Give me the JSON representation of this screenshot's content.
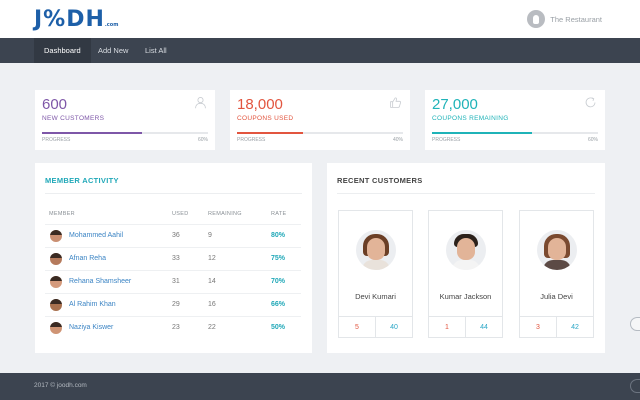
{
  "header": {
    "logo_text": "J%DH",
    "logo_sub": ".com",
    "user_name": "The Restaurant",
    "user_icon": "lightbulb-avatar"
  },
  "nav": {
    "items": [
      {
        "label": "Dashboard",
        "active": true
      },
      {
        "label": "Add New",
        "active": false
      },
      {
        "label": "List All",
        "active": false
      }
    ]
  },
  "stats": [
    {
      "value": "600",
      "label": "NEW CUSTOMERS",
      "progress_label": "PROGRESS",
      "progress_text": "60%",
      "progress": 0.6,
      "color": "#7e57a8",
      "icon": "user-icon"
    },
    {
      "value": "18,000",
      "label": "COUPONS USED",
      "progress_label": "PROGRESS",
      "progress_text": "40%",
      "progress": 0.4,
      "color": "#e2553f",
      "icon": "thumbs-up-icon"
    },
    {
      "value": "27,000",
      "label": "COUPONS REMAINING",
      "progress_label": "PROGRESS",
      "progress_text": "60%",
      "progress": 0.6,
      "color": "#1fb3b8",
      "icon": "refresh-icon"
    }
  ],
  "member_activity": {
    "title": "MEMBER ACTIVITY",
    "columns": [
      "MEMBER",
      "USED",
      "REMAINING",
      "RATE"
    ],
    "rows": [
      {
        "name": "Mohammed Aahil",
        "used": "36",
        "remaining": "9",
        "rate": "80%"
      },
      {
        "name": "Afnan Reha",
        "used": "33",
        "remaining": "12",
        "rate": "75%"
      },
      {
        "name": "Rehana Shamsheer",
        "used": "31",
        "remaining": "14",
        "rate": "70%"
      },
      {
        "name": "Al Rahim Khan",
        "used": "29",
        "remaining": "16",
        "rate": "66%"
      },
      {
        "name": "Naziya Kiswer",
        "used": "23",
        "remaining": "22",
        "rate": "50%"
      }
    ]
  },
  "recent_customers": {
    "title": "RECENT CUSTOMERS",
    "customers": [
      {
        "name": "Devi Kumari",
        "left": "5",
        "right": "40"
      },
      {
        "name": "Kumar Jackson",
        "left": "1",
        "right": "44"
      },
      {
        "name": "Julia Devi",
        "left": "3",
        "right": "42"
      }
    ]
  },
  "footer": {
    "text": "2017 © joodh.com"
  },
  "colors": {
    "brand": "#1d5fa8",
    "nav_bg": "#3c4450",
    "accent_teal": "#20a8b8",
    "link_blue": "#3b84c4"
  }
}
